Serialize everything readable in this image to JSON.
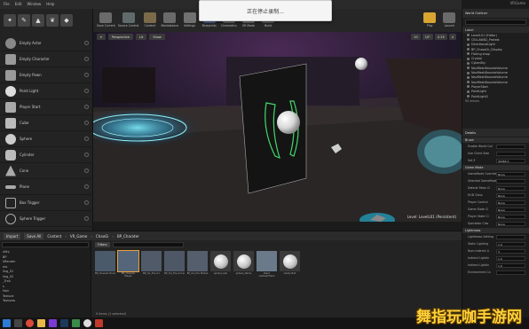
{
  "window": {
    "project": "VRGame"
  },
  "menu": [
    "File",
    "Edit",
    "Window",
    "Help"
  ],
  "toolbar": [
    "Save Current",
    "Source Control",
    "Content",
    "Marketplace",
    "Settings",
    "Blueprints",
    "Cinematics",
    "VR Mode",
    "Build",
    "Play",
    "Launch"
  ],
  "toast": "正在停止录制...",
  "modes": {
    "items": [
      "Empty Actor",
      "Empty Character",
      "Empty Pawn",
      "Point Light",
      "Player Start",
      "Cube",
      "Sphere",
      "Cylinder",
      "Cone",
      "Plane",
      "Box Trigger",
      "Sphere Trigger"
    ]
  },
  "viewport": {
    "buttons": [
      "Perspective",
      "Lit",
      "Show"
    ],
    "right_buttons": [
      "10",
      "10°",
      "0.25",
      "4"
    ],
    "level": "Level: LevelL01 (Persistent)"
  },
  "outliner": {
    "title": "World Outliner",
    "column": "Label",
    "items": [
      "LevelL01 (Editor)",
      "CELLAW82_Protest",
      "DirectionalLight",
      "BP_ChaosOr_Display",
      "Flaring shop",
      "Crystal",
      "CyberSky",
      "NavMeshBoundsVolume",
      "NavMeshBoundsVolume",
      "NavMeshBoundsVolume",
      "NavMeshBoundsVolume",
      "PlayerStart",
      "PointLight",
      "PointLight2"
    ],
    "count": "93 actors"
  },
  "details": {
    "title": "Details",
    "sections": [
      {
        "name": "Brush",
        "rows": [
          {
            "k": "Enable World Cull",
            "v": ""
          },
          {
            "k": "Use Client Side",
            "v": ""
          },
          {
            "k": "Set Z",
            "v": "49464.0"
          }
        ]
      },
      {
        "name": "Game Mode",
        "rows": [
          {
            "k": "GameMode Override",
            "v": "None"
          },
          {
            "k": "Selected GameMode",
            "v": ""
          },
          {
            "k": "Default Pawn Cl",
            "v": "None"
          },
          {
            "k": "HUD Class",
            "v": "None"
          },
          {
            "k": "Player Control",
            "v": "None"
          },
          {
            "k": "Game State Cl",
            "v": "None"
          },
          {
            "k": "Player State Cl",
            "v": "None"
          },
          {
            "k": "Spectator Clas",
            "v": "None"
          }
        ]
      },
      {
        "name": "Lightmass",
        "rows": [
          {
            "k": "Lightmass Setting",
            "v": ""
          },
          {
            "k": "Static Lighting",
            "v": "1.0"
          },
          {
            "k": "Num Indirect Li",
            "v": "3"
          },
          {
            "k": "Indirect Lightin",
            "v": "1.0"
          },
          {
            "k": "Indirect Lightin",
            "v": "1.0"
          },
          {
            "k": "Environment Co",
            "v": ""
          }
        ]
      }
    ]
  },
  "content_browser": {
    "import": "Import",
    "save_all": "Save All",
    "crumbs": [
      "Content",
      "VR_Game",
      "ChaoGi",
      "BP_Charater"
    ],
    "filter": "Filters",
    "folders": [
      "ntity",
      "BP",
      "hRender",
      "mo",
      "ling_01",
      "ling_02",
      "_Trail",
      "s",
      "Hair",
      "Texture",
      "Textures"
    ],
    "assets": [
      "BP_ChaosGi Hand",
      "BP_ChaosGi Player",
      "BP_CG_Fire Arr",
      "BP_CG_Fire Arrow",
      "BP_CG_Fire Mobile",
      "sphere_ball",
      "sphere_flame",
      "Stard LambertTrash",
      "Vanity Ball"
    ],
    "status": "9 items (1 selected)"
  },
  "watermark": "舞指玩咖手游网"
}
